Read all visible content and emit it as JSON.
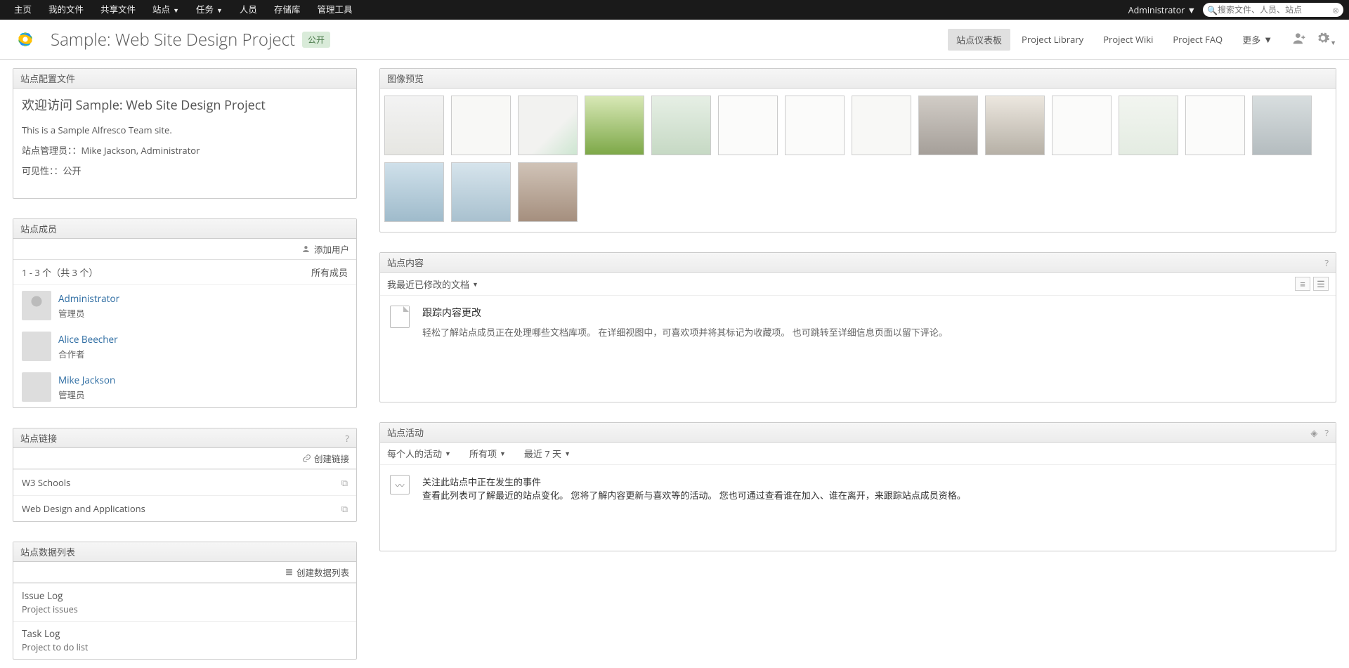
{
  "topbar": {
    "menu": [
      "主页",
      "我的文件",
      "共享文件",
      "站点",
      "任务",
      "人员",
      "存储库",
      "管理工具"
    ],
    "dropdown_indices": [
      3,
      4
    ],
    "admin": "Administrator",
    "search_placeholder": "搜索文件、人员、站点"
  },
  "header": {
    "title": "Sample: Web Site Design Project",
    "badge": "公开",
    "tabs": [
      "站点仪表板",
      "Project Library",
      "Project Wiki",
      "Project FAQ"
    ],
    "active_tab": 0,
    "more": "更多"
  },
  "site_profile": {
    "title": "站点配置文件",
    "welcome": "欢迎访问 Sample: Web Site Design Project",
    "description": "This is a Sample Alfresco Team site.",
    "managers_label": "站点管理员：",
    "managers_value": "：Mike Jackson, Administrator",
    "visibility_label": "可见性：",
    "visibility_value": "：公开"
  },
  "members": {
    "title": "站点成员",
    "add_user": "添加用户",
    "count": "1 - 3 个（共 3 个）",
    "all": "所有成员",
    "list": [
      {
        "name": "Administrator",
        "role": "管理员",
        "avatar": "default"
      },
      {
        "name": "Alice Beecher",
        "role": "合作者",
        "avatar": "a"
      },
      {
        "name": "Mike Jackson",
        "role": "管理员",
        "avatar": "b"
      }
    ]
  },
  "links": {
    "title": "站点链接",
    "create": "创建链接",
    "items": [
      "W3 Schools",
      "Web Design and Applications"
    ]
  },
  "datalists": {
    "title": "站点数据列表",
    "create": "创建数据列表",
    "items": [
      {
        "title": "Issue Log",
        "sub": "Project issues"
      },
      {
        "title": "Task Log",
        "sub": "Project to do list"
      }
    ]
  },
  "image_preview": {
    "title": "图像预览",
    "count": 17
  },
  "site_content": {
    "title": "站点内容",
    "filter": "我最近已修改的文档",
    "info_title": "跟踪内容更改",
    "info_desc": "轻松了解站点成员正在处理哪些文档库项。 在详细视图中，可喜欢项并将其标记为收藏项。 也可跳转至详细信息页面以留下评论。"
  },
  "site_activities": {
    "title": "站点活动",
    "filters": [
      "每个人的活动",
      "所有项",
      "最近 7 天"
    ],
    "info_title": "关注此站点中正在发生的事件",
    "info_desc": "查看此列表可了解最近的站点变化。 您将了解内容更新与喜欢等的活动。 您也可通过查看谁在加入、谁在离开，来跟踪站点成员资格。"
  }
}
